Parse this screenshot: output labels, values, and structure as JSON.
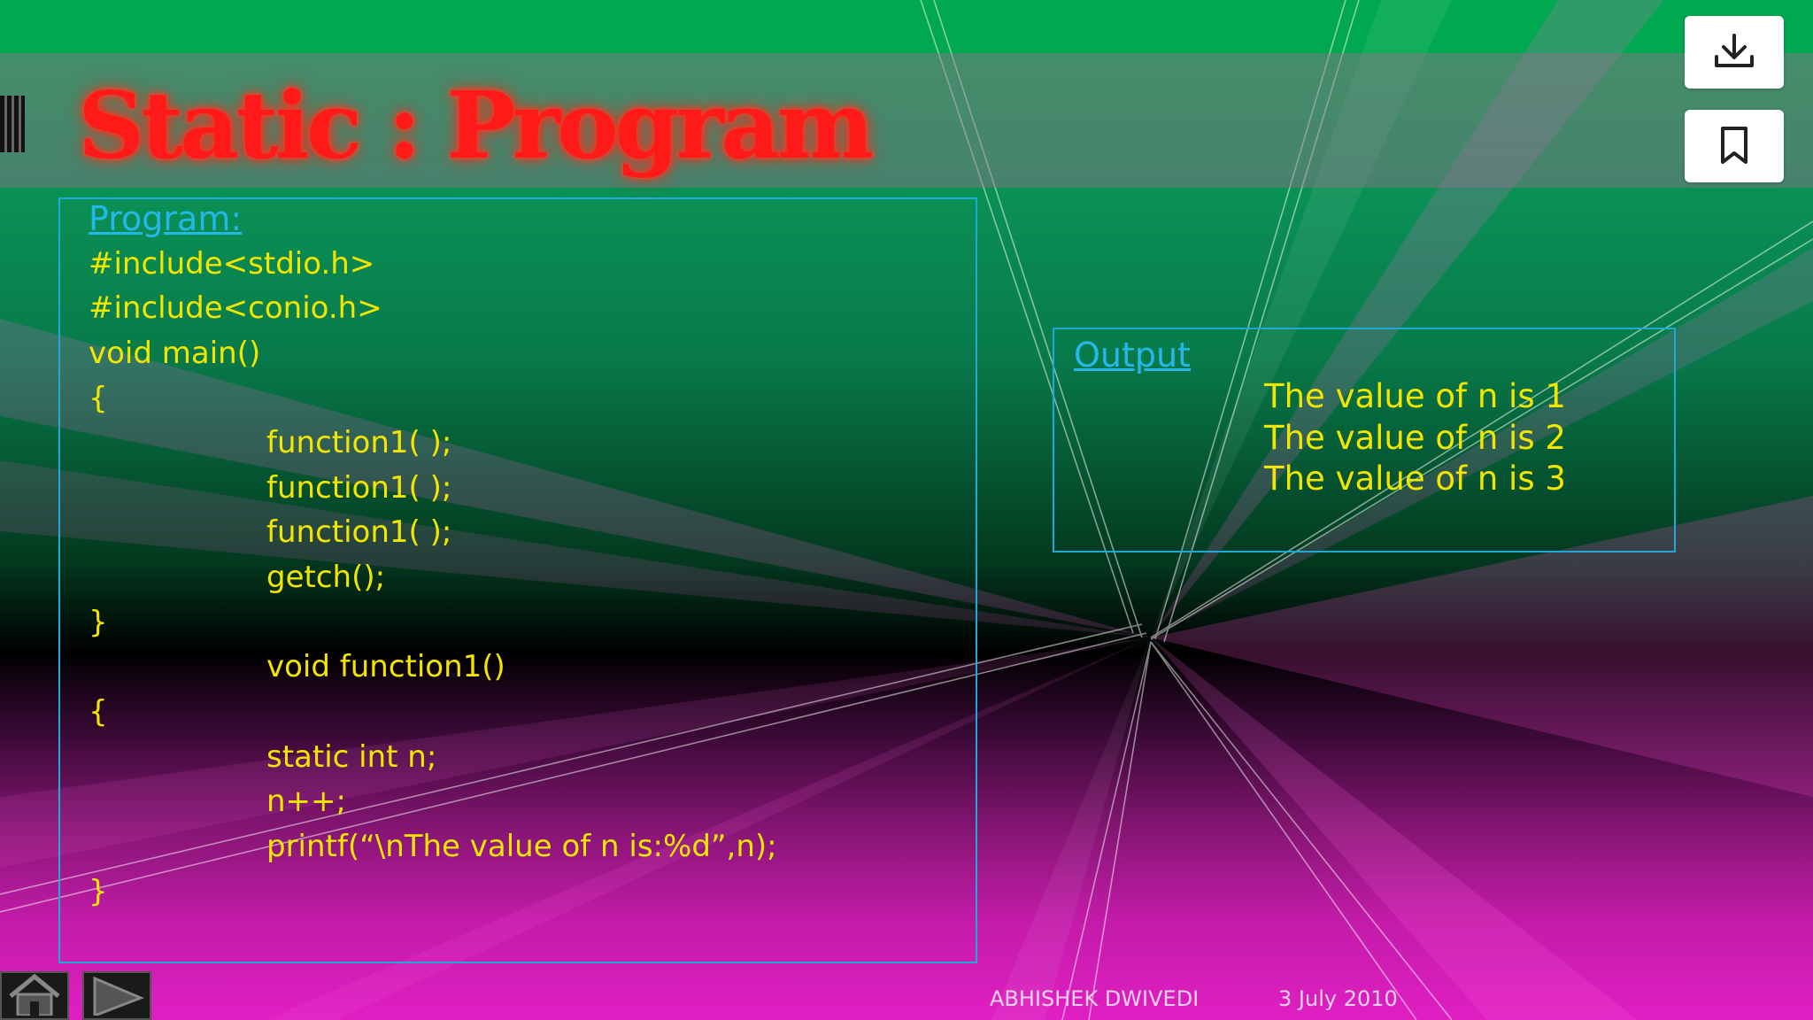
{
  "slide": {
    "title": "Static : Program",
    "program": {
      "heading": "Program:",
      "lines": [
        "#include<stdio.h>",
        "#include<conio.h>",
        "void main()",
        "{",
        "function1( );",
        "function1( );",
        "function1( );",
        "getch();",
        "}",
        "void function1()",
        "{",
        "static int n;",
        "n++;",
        "printf(“\\nThe value of n is:%d”,n);",
        "}"
      ]
    },
    "output": {
      "heading": "Output",
      "lines": [
        "The value of n is 1",
        "The value of n is 2",
        "The value of n is 3"
      ]
    },
    "footer": {
      "author": "ABHISHEK DWIVEDI",
      "date": "3 July 2010"
    }
  },
  "toolbar": {
    "download_icon": "download-icon",
    "bookmark_icon": "bookmark-icon"
  },
  "navigation": {
    "home_icon": "home-icon",
    "next_icon": "play-next-icon"
  },
  "colors": {
    "title": "#ff1a1a",
    "code_text": "#f2e600",
    "heading_link": "#23b8e8",
    "box_border": "#1fa9d8",
    "top_band": "#00a84f",
    "bottom_band": "#e01fc3"
  }
}
